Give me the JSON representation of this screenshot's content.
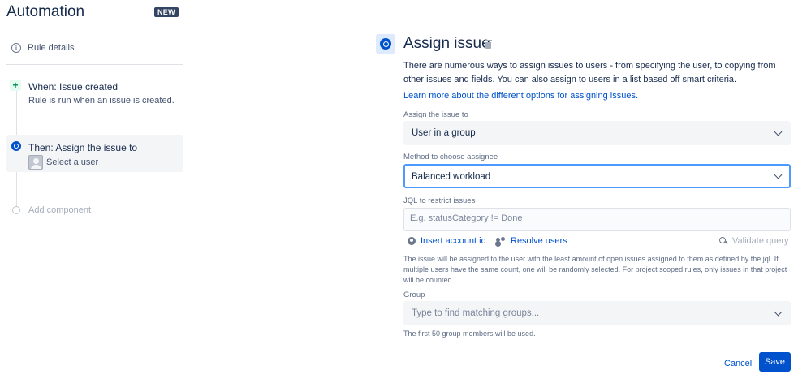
{
  "sidebar": {
    "title": "Automation",
    "badge": "NEW",
    "rule_details": "Rule details",
    "trigger": {
      "title": "When: Issue created",
      "description": "Rule is run when an issue is created."
    },
    "action": {
      "title": "Then: Assign the issue to",
      "description": "Select a user"
    },
    "add_component": "Add component"
  },
  "panel": {
    "title": "Assign issue",
    "intro": "There are numerous ways to assign issues to users - from specifying the user, to copying from other issues and fields. You can also assign to users in a list based off smart criteria.",
    "learn_link": "Learn more about the different options for assigning issues.",
    "assign_to": {
      "label": "Assign the issue to",
      "value": "User in a group"
    },
    "method": {
      "label": "Method to choose assignee",
      "value": "Balanced workload"
    },
    "jql": {
      "label": "JQL to restrict issues",
      "placeholder": "E.g. statusCategory != Done",
      "value": ""
    },
    "links": {
      "insert_account_id": "Insert account id",
      "resolve_users": "Resolve users",
      "validate_query": "Validate query"
    },
    "method_help": "The issue will be assigned to the user with the least amount of open issues assigned to them as defined by the jql. If multiple users have the same count, one will be randomly selected. For project scoped rules, only issues in that project will be counted.",
    "group": {
      "label": "Group",
      "placeholder": "Type to find matching groups...",
      "help": "The first 50 group members will be used."
    }
  },
  "footer": {
    "cancel_label": "Cancel",
    "save_label": "Save"
  },
  "colors": {
    "primary": "#0052cc",
    "success": "#00875a",
    "text": "#172b4d",
    "muted": "#5e6c84",
    "focus": "#4c9aff"
  }
}
